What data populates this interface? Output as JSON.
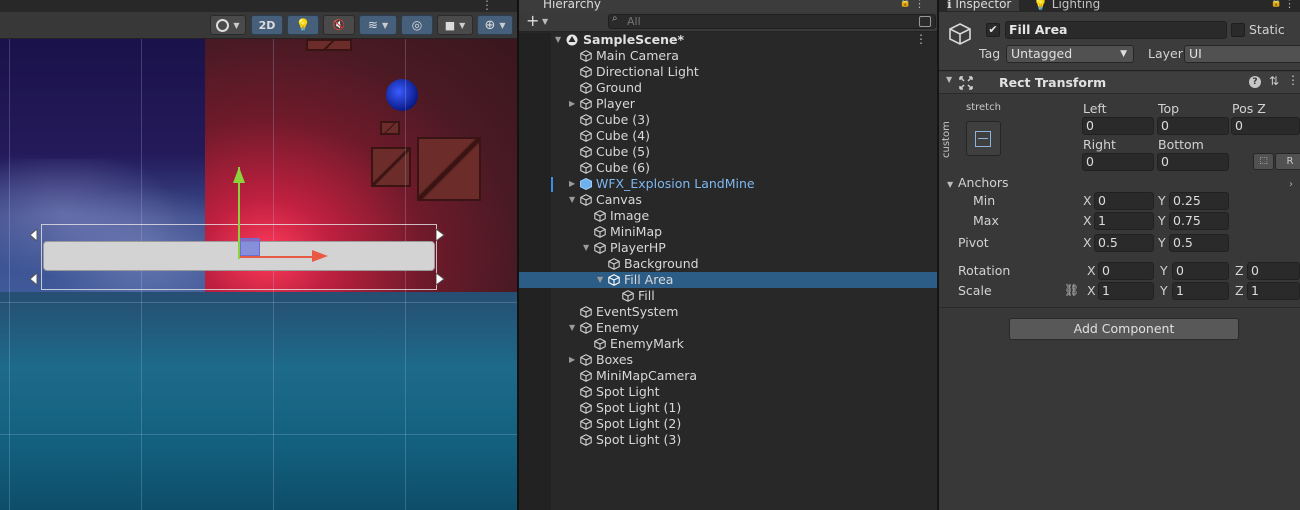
{
  "scene": {
    "toolbar": {
      "mode_2d_label": "2D"
    }
  },
  "hierarchy": {
    "tab_label": "Hierarchy",
    "add_label": "+",
    "search_placeholder": "All",
    "scene_name": "SampleScene*",
    "items": [
      {
        "label": "Main Camera",
        "depth": 1,
        "arrow": "",
        "kind": "object"
      },
      {
        "label": "Directional Light",
        "depth": 1,
        "arrow": "",
        "kind": "object"
      },
      {
        "label": "Ground",
        "depth": 1,
        "arrow": "",
        "kind": "object"
      },
      {
        "label": "Player",
        "depth": 1,
        "arrow": "collapsed",
        "kind": "object"
      },
      {
        "label": "Cube (3)",
        "depth": 1,
        "arrow": "",
        "kind": "object"
      },
      {
        "label": "Cube (4)",
        "depth": 1,
        "arrow": "",
        "kind": "object"
      },
      {
        "label": "Cube (5)",
        "depth": 1,
        "arrow": "",
        "kind": "object"
      },
      {
        "label": "Cube (6)",
        "depth": 1,
        "arrow": "",
        "kind": "object"
      },
      {
        "label": "WFX_Explosion LandMine",
        "depth": 1,
        "arrow": "collapsed",
        "kind": "prefab"
      },
      {
        "label": "Canvas",
        "depth": 1,
        "arrow": "expanded",
        "kind": "object"
      },
      {
        "label": "Image",
        "depth": 2,
        "arrow": "",
        "kind": "object"
      },
      {
        "label": "MiniMap",
        "depth": 2,
        "arrow": "",
        "kind": "object"
      },
      {
        "label": "PlayerHP",
        "depth": 2,
        "arrow": "expanded",
        "kind": "object"
      },
      {
        "label": "Background",
        "depth": 3,
        "arrow": "",
        "kind": "object"
      },
      {
        "label": "Fill Area",
        "depth": 3,
        "arrow": "expanded",
        "kind": "object",
        "selected": true
      },
      {
        "label": "Fill",
        "depth": 4,
        "arrow": "",
        "kind": "object"
      },
      {
        "label": "EventSystem",
        "depth": 1,
        "arrow": "",
        "kind": "object"
      },
      {
        "label": "Enemy",
        "depth": 1,
        "arrow": "expanded",
        "kind": "object"
      },
      {
        "label": "EnemyMark",
        "depth": 2,
        "arrow": "",
        "kind": "object"
      },
      {
        "label": "Boxes",
        "depth": 1,
        "arrow": "collapsed",
        "kind": "object"
      },
      {
        "label": "MiniMapCamera",
        "depth": 1,
        "arrow": "",
        "kind": "object"
      },
      {
        "label": "Spot Light",
        "depth": 1,
        "arrow": "",
        "kind": "object"
      },
      {
        "label": "Spot Light (1)",
        "depth": 1,
        "arrow": "",
        "kind": "object"
      },
      {
        "label": "Spot Light (2)",
        "depth": 1,
        "arrow": "",
        "kind": "object"
      },
      {
        "label": "Spot Light (3)",
        "depth": 1,
        "arrow": "",
        "kind": "object"
      }
    ]
  },
  "inspector": {
    "tab_inspector": "Inspector",
    "tab_lighting": "Lighting",
    "object_name": "Fill Area",
    "active": true,
    "static_label": "Static",
    "static": false,
    "tag_label": "Tag",
    "tag_value": "Untagged",
    "layer_label": "Layer",
    "layer_value": "UI",
    "rect_transform": {
      "title": "Rect Transform",
      "preset_horizontal": "stretch",
      "preset_vertical": "custom",
      "left_label": "Left",
      "left": "0",
      "top_label": "Top",
      "top": "0",
      "posz_label": "Pos Z",
      "posz": "0",
      "right_label": "Right",
      "right": "0",
      "bottom_label": "Bottom",
      "bottom": "0",
      "raw_label": "R",
      "anchors_label": "Anchors",
      "min_label": "Min",
      "min_x": "0",
      "min_y": "0.25",
      "max_label": "Max",
      "max_x": "1",
      "max_y": "0.75",
      "pivot_label": "Pivot",
      "pivot_x": "0.5",
      "pivot_y": "0.5",
      "rotation_label": "Rotation",
      "rot_x": "0",
      "rot_y": "0",
      "rot_z": "0",
      "scale_label": "Scale",
      "scale_x": "1",
      "scale_y": "1",
      "scale_z": "1",
      "x": "X",
      "y": "Y",
      "z": "Z"
    },
    "add_component_label": "Add Component"
  }
}
